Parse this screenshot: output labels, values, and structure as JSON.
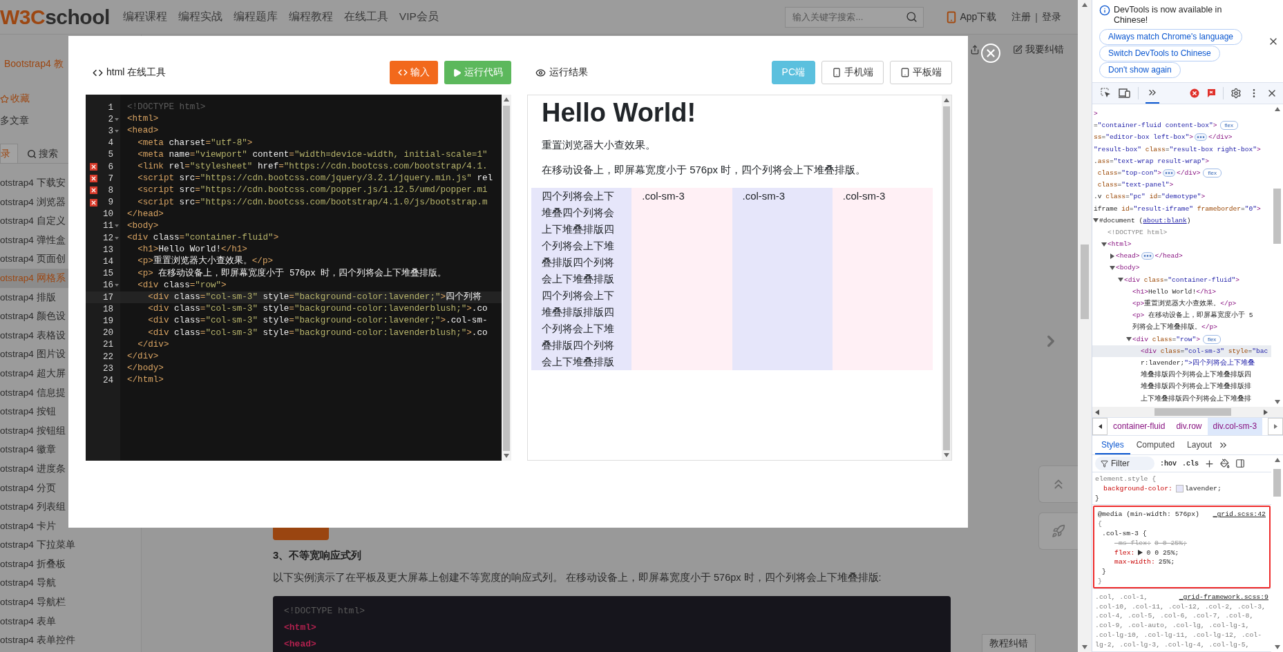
{
  "header": {
    "logo": {
      "accent": "W3C",
      "rest": "school"
    },
    "nav": [
      "编程课程",
      "编程实战",
      "编程题库",
      "编程教程",
      "在线工具",
      "VIP会员"
    ],
    "search": {
      "placeholder": "输入关键字搜索..."
    },
    "app_download": "App下载",
    "register": "注册",
    "separator": "|",
    "login": "登录"
  },
  "sidebar": {
    "course_title": "Bootstrap4 教",
    "favorite": "收藏",
    "more_articles": "多文章",
    "tabs": [
      {
        "label": "录",
        "selected": true
      },
      {
        "label": "搜索",
        "selected": false
      }
    ],
    "items": [
      {
        "label": "otstrap4 下载安",
        "selected": false
      },
      {
        "label": "otstrap4 浏览器",
        "selected": false
      },
      {
        "label": "otstrap4 自定义",
        "selected": false
      },
      {
        "label": "otstrap4 弹性盒",
        "selected": false
      },
      {
        "label": "otstrap4 页面创",
        "selected": false
      },
      {
        "label": "otstrap4 网格系",
        "selected": true
      },
      {
        "label": "otstrap4 排版",
        "selected": false
      },
      {
        "label": "otstrap4 颜色设",
        "selected": false
      },
      {
        "label": "otstrap4 表格设",
        "selected": false
      },
      {
        "label": "otstrap4 图片设",
        "selected": false
      },
      {
        "label": "otstrap4 超大屏",
        "selected": false
      },
      {
        "label": "otstrap4 信息提",
        "selected": false
      },
      {
        "label": "otstrap4 按钮",
        "selected": false
      },
      {
        "label": "otstrap4 按钮组",
        "selected": false
      },
      {
        "label": "otstrap4 徽章",
        "selected": false
      },
      {
        "label": "otstrap4 进度条",
        "selected": false
      },
      {
        "label": "otstrap4 分页",
        "selected": false
      },
      {
        "label": "otstrap4 列表组",
        "selected": false
      },
      {
        "label": "otstrap4 卡片",
        "selected": false
      },
      {
        "label": "otstrap4 下拉菜单",
        "selected": false
      },
      {
        "label": "otstrap4 折叠板",
        "selected": false
      },
      {
        "label": "otstrap4 导航",
        "selected": false
      },
      {
        "label": "otstrap4 导航栏",
        "selected": false
      },
      {
        "label": "otstrap4 表单",
        "selected": false
      },
      {
        "label": "otstrap4 表单控件",
        "selected": false
      }
    ]
  },
  "article": {
    "heading": "3、不等宽响应式列",
    "paragraph": "以下实例演示了在平板及更大屏幕上创建不等宽度的响应式列。 在移动设备上，即屏幕宽度小于 576px 时，四个列将会上下堆叠排版:",
    "code_lines": [
      "<!DOCTYPE html>",
      "<html>",
      "<head>"
    ]
  },
  "page_tools": {
    "report": "我要纠错",
    "tutorial_report": "教程纠错"
  },
  "modal": {
    "editor_title": "html 在线工具",
    "input_button": "输入",
    "run_button": "运行代码",
    "editor_lines": [
      {
        "number": "1",
        "code": "<!DOCTYPE html>",
        "error": false,
        "foldable": false,
        "current": false
      },
      {
        "number": "2",
        "code": "<html>",
        "error": false,
        "foldable": true,
        "current": false
      },
      {
        "number": "3",
        "code": "<head>",
        "error": false,
        "foldable": true,
        "current": false
      },
      {
        "number": "4",
        "code": "  <meta charset=\"utf-8\">",
        "error": false,
        "foldable": false,
        "current": false
      },
      {
        "number": "5",
        "code": "  <meta name=\"viewport\" content=\"width=device-width, initial-scale=1\"",
        "error": false,
        "foldable": false,
        "current": false
      },
      {
        "number": "6",
        "code": "  <link rel=\"stylesheet\" href=\"https://cdn.bootcss.com/bootstrap/4.1.",
        "error": true,
        "foldable": false,
        "current": false
      },
      {
        "number": "7",
        "code": "  <script src=\"https://cdn.bootcss.com/jquery/3.2.1/jquery.min.js\" rel",
        "error": true,
        "foldable": false,
        "current": false
      },
      {
        "number": "8",
        "code": "  <script src=\"https://cdn.bootcss.com/popper.js/1.12.5/umd/popper.mi",
        "error": true,
        "foldable": false,
        "current": false
      },
      {
        "number": "9",
        "code": "  <script src=\"https://cdn.bootcss.com/bootstrap/4.1.0/js/bootstrap.m",
        "error": true,
        "foldable": false,
        "current": false
      },
      {
        "number": "10",
        "code": "</head>",
        "error": false,
        "foldable": false,
        "current": false
      },
      {
        "number": "11",
        "code": "<body>",
        "error": false,
        "foldable": true,
        "current": false
      },
      {
        "number": "12",
        "code": "<div class=\"container-fluid\">",
        "error": false,
        "foldable": true,
        "current": false
      },
      {
        "number": "13",
        "code": "  <h1>Hello World!</h1>",
        "error": false,
        "foldable": false,
        "current": false
      },
      {
        "number": "14",
        "code": "  <p>重置浏览器大小查效果。</p>",
        "error": false,
        "foldable": false,
        "current": false
      },
      {
        "number": "15",
        "code": "  <p> 在移动设备上，即屏幕宽度小于 576px 时，四个列将会上下堆叠排版。",
        "error": false,
        "foldable": false,
        "current": false
      },
      {
        "number": "16",
        "code": "  <div class=\"row\">",
        "error": false,
        "foldable": true,
        "current": false
      },
      {
        "number": "17",
        "code": "    <div class=\"col-sm-3\" style=\"background-color:lavender;\">四个列将",
        "error": false,
        "foldable": false,
        "current": true
      },
      {
        "number": "18",
        "code": "    <div class=\"col-sm-3\" style=\"background-color:lavenderblush;\">.co",
        "error": false,
        "foldable": false,
        "current": false
      },
      {
        "number": "19",
        "code": "    <div class=\"col-sm-3\" style=\"background-color:lavender;\">.col-sm-",
        "error": false,
        "foldable": false,
        "current": false
      },
      {
        "number": "20",
        "code": "    <div class=\"col-sm-3\" style=\"background-color:lavenderblush;\">.co",
        "error": false,
        "foldable": false,
        "current": false
      },
      {
        "number": "21",
        "code": "  </div>",
        "error": false,
        "foldable": false,
        "current": false
      },
      {
        "number": "22",
        "code": "</div>",
        "error": false,
        "foldable": false,
        "current": false
      },
      {
        "number": "23",
        "code": "</body>",
        "error": false,
        "foldable": false,
        "current": false
      },
      {
        "number": "24",
        "code": "</html>",
        "error": false,
        "foldable": false,
        "current": false
      }
    ],
    "result_title": "运行结果",
    "devices": [
      {
        "label": "PC端",
        "selected": true,
        "kind": "desktop"
      },
      {
        "label": "手机端",
        "selected": false,
        "kind": "phone"
      },
      {
        "label": "平板端",
        "selected": false,
        "kind": "tablet"
      }
    ],
    "result": {
      "heading": "Hello World!",
      "paragraphs": [
        "重置浏览器大小查效果。",
        "在移动设备上，即屏幕宽度小于 576px 时，四个列将会上下堆叠排版。"
      ],
      "columns": [
        {
          "text": "四个列将会上下堆叠四个列将会上下堆叠排版四个列将会上下堆叠排版四个列将会上下堆叠排版四个列将会上下堆叠排版排版四个列将会上下堆叠排版四个列将会上下堆叠排版",
          "color": "#e6e6fa"
        },
        {
          "text": ".col-sm-3",
          "color": "#fff0f5"
        },
        {
          "text": ".col-sm-3",
          "color": "#e6e6fa"
        },
        {
          "text": ".col-sm-3",
          "color": "#fff0f5"
        }
      ]
    }
  },
  "devtools": {
    "notice": {
      "message": "DevTools is now available in Chinese!",
      "buttons": [
        "Always match Chrome's language",
        "Switch DevTools to Chinese",
        "Don't show again"
      ]
    },
    "dom": [
      {
        "lines": [
          ">"
        ],
        "selected": false
      },
      {
        "lines": [
          "=\"container-fluid content-box\">"
        ],
        "badge": "flex",
        "selected": false
      },
      {
        "lines": [
          "ss=\"editor-box left-box\">"
        ],
        "collapsed": true,
        "tail": "</div>",
        "selected": false
      },
      {
        "lines": [
          "\"result-box\" class=\"result-box right-box\">"
        ],
        "selected": false
      },
      {
        "lines": [
          ".ass=\"text-wrap result-wrap\">"
        ],
        "selected": false
      },
      {
        "lines": [
          " class=\"top-con\">"
        ],
        "collapsed": true,
        "tail": "</div>",
        "badge": "flex",
        "selected": false
      },
      {
        "lines": [
          " class=\"text-panel\">"
        ],
        "selected": false
      },
      {
        "lines": [
          ".v class=\"pc\" id=\"demotype\">"
        ],
        "selected": false
      },
      {
        "lines": [
          "iframe id=\"result-iframe\" frameborder=\"0\">"
        ],
        "selected": false
      },
      {
        "lines": [
          "#document ("
        ],
        "link": "about:blank",
        "tail": ")",
        "expanded": true,
        "selected": false,
        "children": [
          {
            "lines": [
              "<!DOCTYPE html>"
            ],
            "selected": false
          },
          {
            "lines": [
              "<html>"
            ],
            "expanded": true,
            "selected": false,
            "children": [
              {
                "lines": [
                  "<head>"
                ],
                "expanded": false,
                "collapsed": true,
                "tail": "</head>",
                "selected": false
              },
              {
                "lines": [
                  "<body>"
                ],
                "expanded": true,
                "selected": false,
                "children": [
                  {
                    "lines": [
                      "<div class=\"container-fluid\">"
                    ],
                    "expanded": true,
                    "selected": false,
                    "children": [
                      {
                        "lines": [
                          "<h1>Hello World!</h1>"
                        ],
                        "selected": false
                      },
                      {
                        "lines": [
                          "<p>重置浏览器大小查效果。</p>"
                        ],
                        "selected": false
                      },
                      {
                        "lines": [
                          "<p> 在移动设备上，即屏幕宽度小于 5",
                          "列将会上下堆叠排版。</p>"
                        ],
                        "selected": false
                      },
                      {
                        "lines": [
                          "<div class=\"row\">"
                        ],
                        "expanded": true,
                        "badge": "flex",
                        "selected": false,
                        "children": [
                          {
                            "lines": [
                              "<div class=\"col-sm-3\" style=\"bac",
                              "r:lavender;\">四个列将会上下堆叠",
                              "堆叠排版四个列将会上下堆叠排版四",
                              "堆叠排版四个列将会上下堆叠排版排",
                              "上下堆叠排版四个列将会上下堆叠排"
                            ],
                            "selected": true
                          }
                        ]
                      }
                    ]
                  }
                ]
              }
            ]
          }
        ]
      }
    ],
    "breadcrumbs": [
      {
        "label": "container-fluid",
        "selected": false
      },
      {
        "label": "div.row",
        "selected": false
      },
      {
        "label": "div.col-sm-3",
        "selected": true
      }
    ],
    "style_tabs": [
      {
        "label": "Styles",
        "selected": true
      },
      {
        "label": "Computed",
        "selected": false
      },
      {
        "label": "Layout",
        "selected": false
      }
    ],
    "filter": {
      "placeholder": "Filter"
    },
    "hov": ":hov",
    "cls": ".cls",
    "element_style": {
      "selector": "element.style {",
      "property": "background-color:",
      "value": "lavender;",
      "close": "}"
    },
    "media_rule": {
      "highlighted": true,
      "query": "@media (min-width: 576px)",
      "source": "_grid.scss:42",
      "open": "{",
      "selector": ".col-sm-3 {",
      "declarations": [
        {
          "property": "-ms-flex:",
          "value": "0 0 25%;",
          "overridden": true,
          "expandable": false
        },
        {
          "property": "flex:",
          "value": "0 0 25%;",
          "overridden": false,
          "expandable": true
        },
        {
          "property": "max-width:",
          "value": "25%;",
          "overridden": false,
          "expandable": false
        }
      ],
      "close_inner": "}",
      "close": "}"
    },
    "grid_rule": {
      "source": "_grid-framework.scss:9",
      "selector_lines": [
        ".col, .col-1,",
        ".col-10, .col-11, .col-12, .col-2, .col-3,",
        ".col-4, .col-5, .col-6, .col-7, .col-8,",
        ".col-9, .col-auto, .col-lg, .col-lg-1,",
        ".col-lg-10, .col-lg-11, .col-lg-12, .col-",
        "lg-2, .col-lg-3, .col-lg-4, .col-lg-5,"
      ]
    }
  }
}
